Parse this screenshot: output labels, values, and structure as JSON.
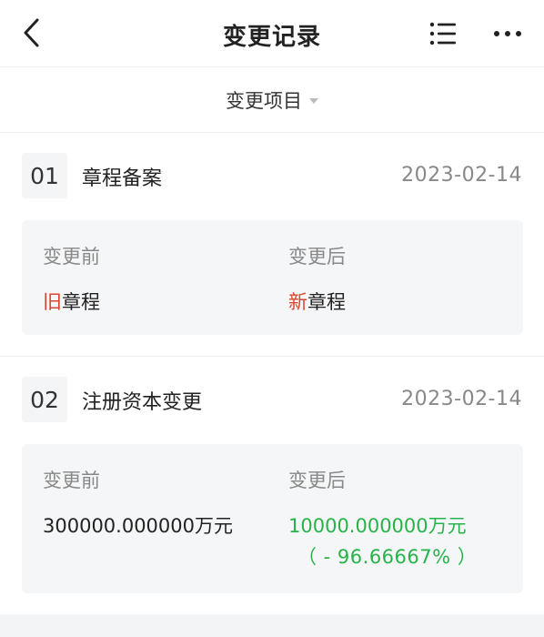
{
  "header": {
    "title": "变更记录",
    "back_icon": "chevron-left-icon",
    "list_icon": "list-icon",
    "more_icon": "more-horizontal-icon"
  },
  "filter": {
    "label": "变更项目",
    "caret_icon": "caret-down-icon"
  },
  "records": [
    {
      "index": "01",
      "title": "章程备案",
      "date": "2023-02-14",
      "before_label": "变更前",
      "after_label": "变更后",
      "before_highlight": "旧",
      "before_rest": "章程",
      "after_highlight": "新",
      "after_rest": "章程"
    },
    {
      "index": "02",
      "title": "注册资本变更",
      "date": "2023-02-14",
      "before_label": "变更前",
      "after_label": "变更后",
      "before_value": "300000.000000万元",
      "after_value": "10000.000000万元",
      "change_percent": "（ - 96.66667% ）"
    }
  ],
  "colors": {
    "highlight_red": "#d9452e",
    "increase_green": "#27b34a",
    "muted_text": "#888888",
    "box_background": "#f5f6f7"
  }
}
